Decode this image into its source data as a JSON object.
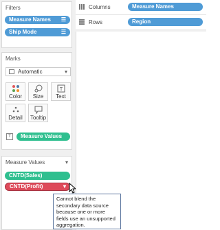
{
  "filters": {
    "title": "Filters",
    "pills": [
      {
        "label": "Measure Names",
        "icon": "filter-list-icon"
      },
      {
        "label": "Ship Mode",
        "icon": "filter-list-icon"
      }
    ]
  },
  "marks": {
    "title": "Marks",
    "mark_type": "Automatic",
    "buttons": [
      {
        "label": "Color",
        "icon": "color-dots-icon"
      },
      {
        "label": "Size",
        "icon": "size-icon"
      },
      {
        "label": "Text",
        "icon": "text-icon"
      },
      {
        "label": "Detail",
        "icon": "detail-icon"
      },
      {
        "label": "Tooltip",
        "icon": "tooltip-icon"
      }
    ],
    "field_pill": {
      "label": "Measure Values",
      "icon": "text-field-icon"
    }
  },
  "measure_values": {
    "title": "Measure Values",
    "pills": [
      {
        "label": "CNTD(Sales)",
        "status": "ok"
      },
      {
        "label": "CNTD(Profit)",
        "status": "error"
      }
    ]
  },
  "shelves": {
    "columns": {
      "label": "Columns",
      "pill": "Measure Names"
    },
    "rows": {
      "label": "Rows",
      "pill": "Region"
    }
  },
  "tooltip": {
    "lines": [
      "Cannot blend the",
      "secondary data source",
      "because one or more",
      "fields use an unsupported",
      "aggregation."
    ]
  },
  "colors": {
    "dimension_pill": "#4f9bd6",
    "measure_pill": "#2fbf8f",
    "error_pill": "#de4a5a"
  }
}
